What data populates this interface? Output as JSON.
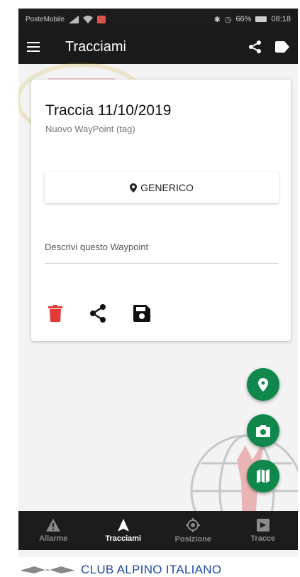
{
  "status_bar": {
    "carrier": "PosteMobile",
    "battery": "66%",
    "time": "08:18"
  },
  "app_bar": {
    "title": "Tracciami",
    "menu_icon": "menu-icon",
    "share_icon": "share-icon",
    "label_icon": "label-icon"
  },
  "card": {
    "title": "Traccia 11/10/2019",
    "subtitle": "Nuovo WayPoint (tag)",
    "tag_button_label": "GENERICO",
    "description_placeholder": "Descrivi questo Waypoint",
    "description_value": "",
    "delete_color": "#e53935"
  },
  "fabs": [
    "place-icon",
    "camera-icon",
    "map-icon"
  ],
  "bottom_nav": {
    "items": [
      {
        "label": "Allarme",
        "icon": "warning-icon"
      },
      {
        "label": "Tracciami",
        "icon": "navigation-icon"
      },
      {
        "label": "Posizione",
        "icon": "location-icon"
      },
      {
        "label": "Tracce",
        "icon": "folder-icon"
      }
    ],
    "active_index": 1
  },
  "footer": {
    "text": "CLUB ALPINO ITALIANO"
  },
  "colors": {
    "fab": "#10884c",
    "bar": "#1a1a1a",
    "footer_text": "#1f4aa0"
  }
}
